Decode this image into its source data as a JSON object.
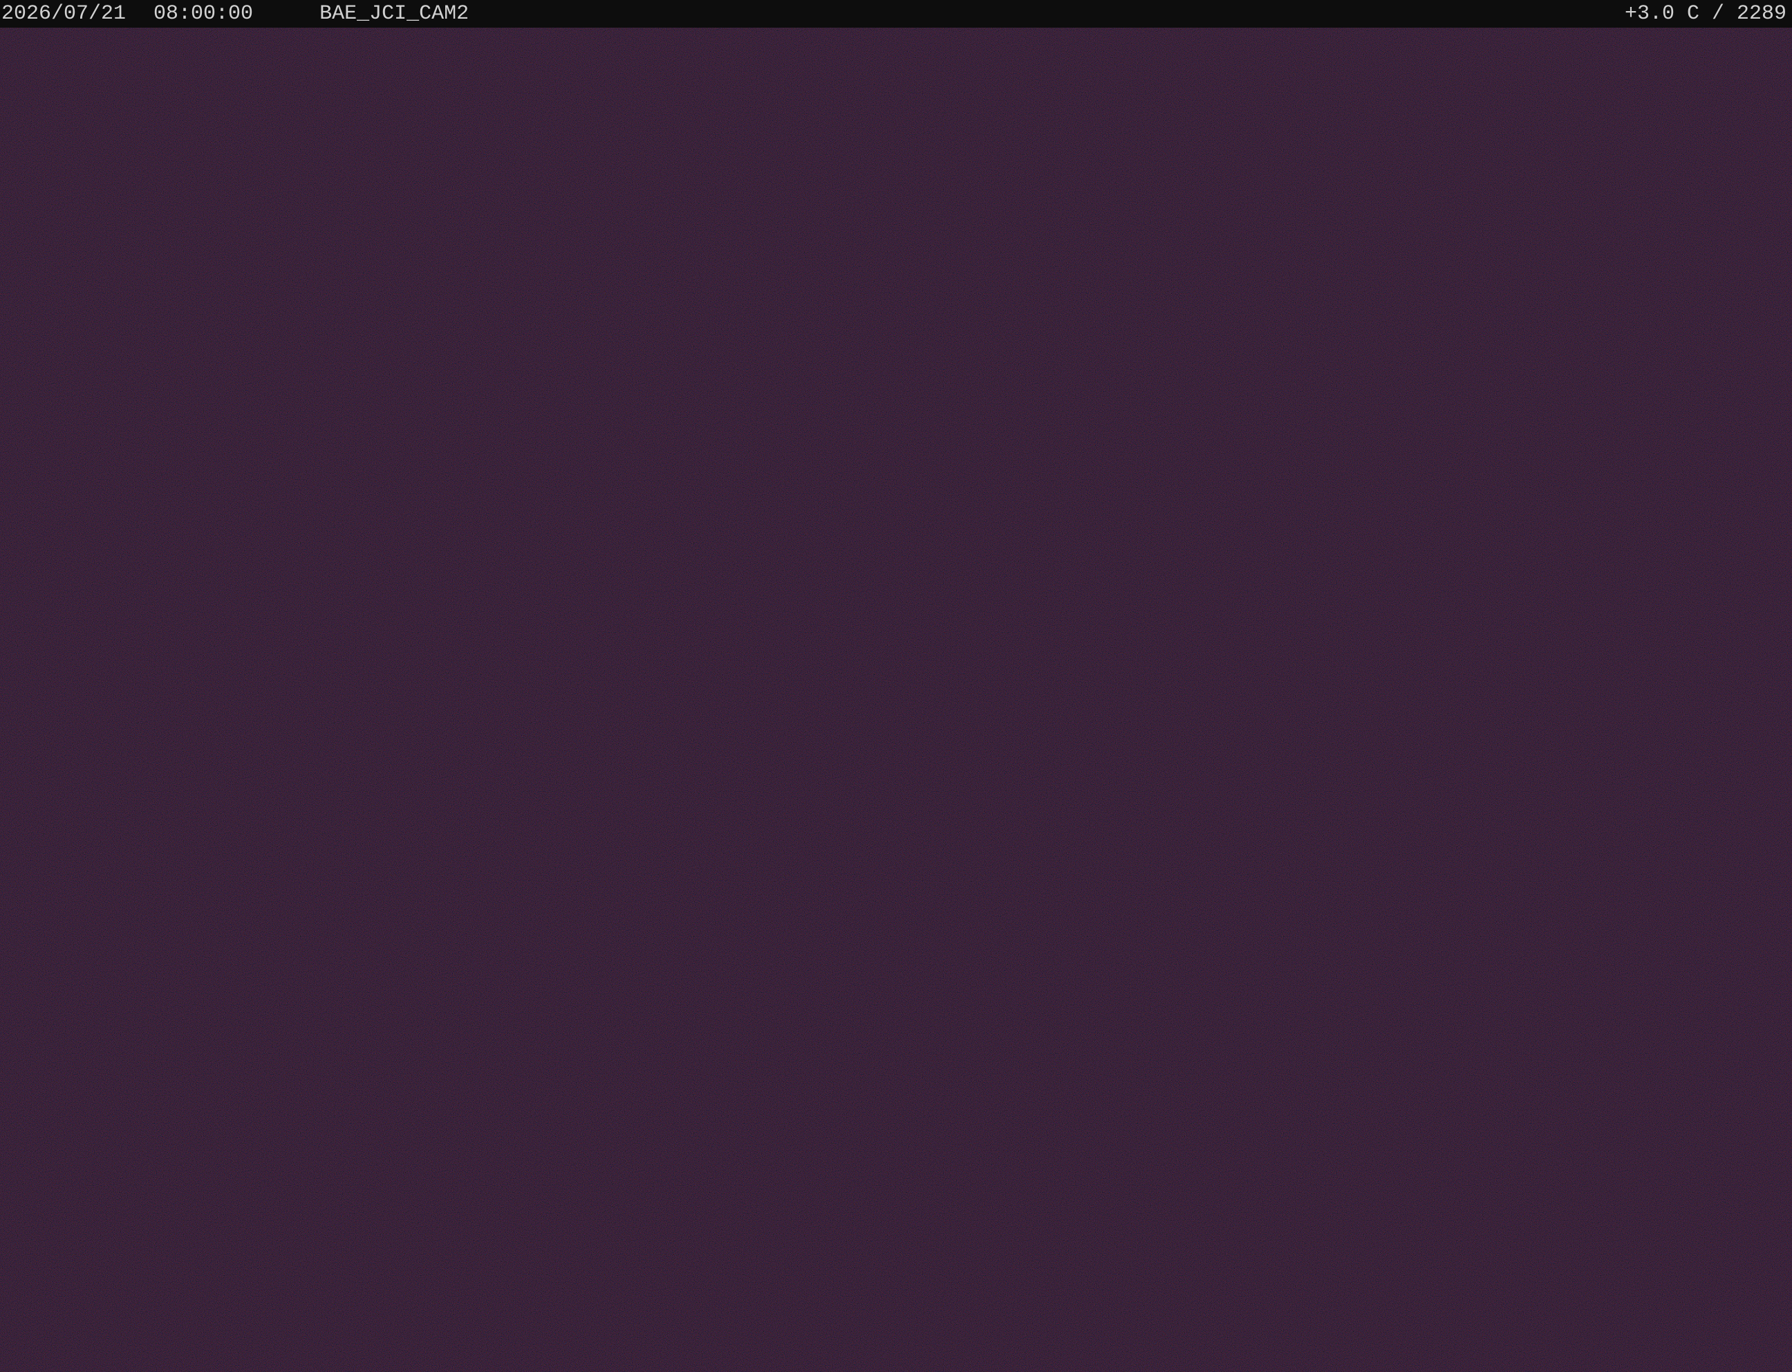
{
  "overlay": {
    "date": "2026/07/21",
    "time": "08:00:00",
    "camera_name": "BAE_JCI_CAM2",
    "readout": "+3.0 C / 2289"
  },
  "colors": {
    "scene_base": "#17141b",
    "overlay_background": "#0d0d0d",
    "overlay_text": "#d2d2d2",
    "noise_red": "#5a1e22",
    "noise_blue": "#24224a"
  }
}
